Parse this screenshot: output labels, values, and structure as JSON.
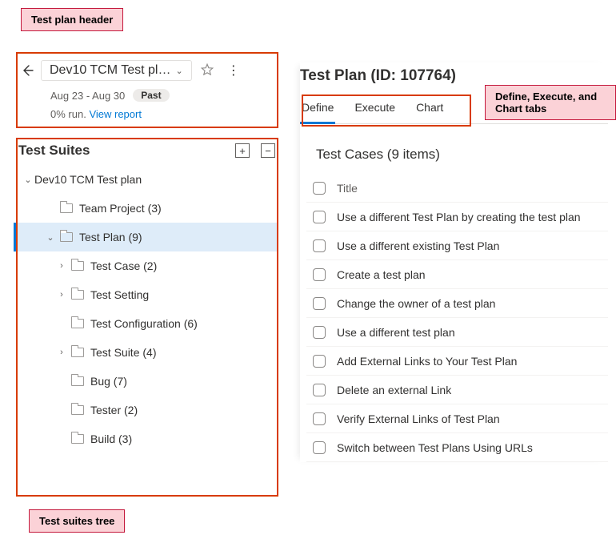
{
  "callouts": {
    "header": "Test plan header",
    "tabs": "Define, Execute, and Chart tabs",
    "tree": "Test suites tree"
  },
  "header": {
    "plan_title": "Dev10 TCM Test pl…",
    "date_range": "Aug 23 - Aug 30",
    "past_label": "Past",
    "run_pct": "0% run.",
    "view_report": "View report"
  },
  "suites": {
    "title": "Test Suites",
    "root": "Dev10 TCM Test plan",
    "nodes": [
      {
        "label": "Team Project (3)",
        "indent": 2,
        "chev": null
      },
      {
        "label": "Test Plan (9)",
        "indent": 2,
        "chev": "down",
        "selected": true
      },
      {
        "label": "Test Case (2)",
        "indent": 3,
        "chev": "right"
      },
      {
        "label": "Test Setting",
        "indent": 3,
        "chev": "right"
      },
      {
        "label": "Test Configuration (6)",
        "indent": 3,
        "chev": null
      },
      {
        "label": "Test Suite (4)",
        "indent": 3,
        "chev": "right"
      },
      {
        "label": "Bug (7)",
        "indent": 3,
        "chev": null
      },
      {
        "label": "Tester (2)",
        "indent": 3,
        "chev": null
      },
      {
        "label": "Build (3)",
        "indent": 3,
        "chev": null
      }
    ]
  },
  "main": {
    "title": "Test Plan (ID: 107764)",
    "tabs": [
      "Define",
      "Execute",
      "Chart"
    ],
    "active_tab": "Define",
    "section_title": "Test Cases (9 items)",
    "col_title": "Title",
    "cases": [
      "Use a different Test Plan by creating the test plan",
      "Use a different existing Test Plan",
      "Create a test plan",
      "Change the owner of a test plan",
      "Use a different test plan",
      "Add External Links to Your Test Plan",
      "Delete an external Link",
      "Verify External Links of Test Plan",
      "Switch between Test Plans Using URLs"
    ]
  }
}
